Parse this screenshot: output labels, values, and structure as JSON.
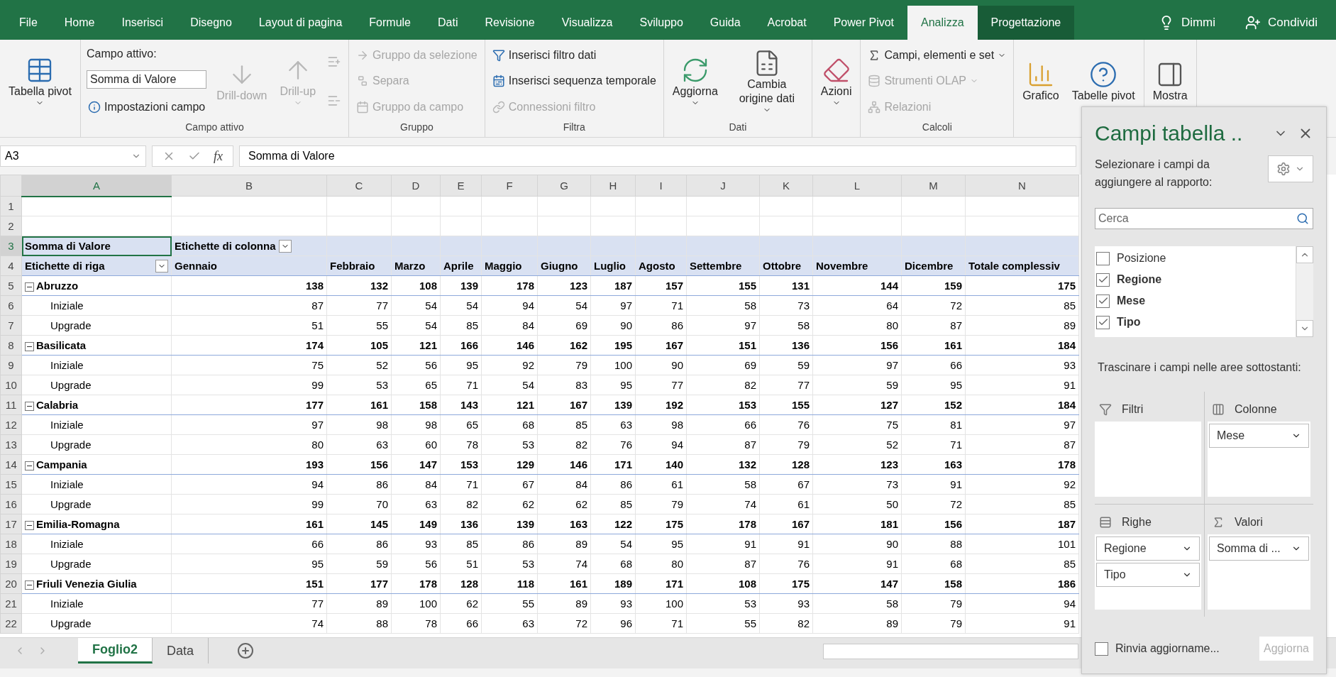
{
  "tabs": [
    {
      "label": "File",
      "selected": false,
      "contextual": false
    },
    {
      "label": "Home",
      "selected": false,
      "contextual": false
    },
    {
      "label": "Inserisci",
      "selected": false,
      "contextual": false
    },
    {
      "label": "Disegno",
      "selected": false,
      "contextual": false
    },
    {
      "label": "Layout di pagina",
      "selected": false,
      "contextual": false
    },
    {
      "label": "Formule",
      "selected": false,
      "contextual": false
    },
    {
      "label": "Dati",
      "selected": false,
      "contextual": false
    },
    {
      "label": "Revisione",
      "selected": false,
      "contextual": false
    },
    {
      "label": "Visualizza",
      "selected": false,
      "contextual": false
    },
    {
      "label": "Sviluppo",
      "selected": false,
      "contextual": false
    },
    {
      "label": "Guida",
      "selected": false,
      "contextual": false
    },
    {
      "label": "Acrobat",
      "selected": false,
      "contextual": false
    },
    {
      "label": "Power Pivot",
      "selected": false,
      "contextual": false
    },
    {
      "label": "Analizza",
      "selected": true,
      "contextual": true
    },
    {
      "label": "Progettazione",
      "selected": false,
      "contextual": true
    }
  ],
  "tell_me": "Dimmi",
  "share": "Condividi",
  "ribbon": [
    {
      "stacks": [
        [
          {
            "kind": "large",
            "label": "Tabella pivot",
            "caret": true,
            "disabled": false
          }
        ]
      ]
    },
    {
      "name": "Campo attivo",
      "stacks": [
        [
          {
            "kind": "label",
            "label": "Campo attivo:"
          },
          {
            "kind": "field",
            "value": "Somma di Valore"
          },
          {
            "kind": "small",
            "label": "Impostazioni campo",
            "caret": false,
            "disabled": false
          }
        ],
        [
          {
            "kind": "large",
            "label": "Drill-down",
            "caret": false,
            "disabled": true
          }
        ],
        [
          {
            "kind": "large",
            "label": "Drill-up",
            "caret": true,
            "disabled": true
          }
        ],
        [
          {
            "kind": "icon",
            "disabled": true
          },
          {
            "kind": "icon",
            "disabled": true
          }
        ]
      ]
    },
    {
      "name": "Gruppo",
      "stacks": [
        [
          {
            "kind": "small",
            "label": "Gruppo da selezione",
            "caret": false,
            "disabled": true
          },
          {
            "kind": "small",
            "label": "Separa",
            "caret": false,
            "disabled": true
          },
          {
            "kind": "small",
            "label": "Gruppo da campo",
            "caret": false,
            "disabled": true
          }
        ]
      ]
    },
    {
      "name": "Filtra",
      "stacks": [
        [
          {
            "kind": "small",
            "label": "Inserisci filtro dati",
            "caret": false,
            "disabled": false
          },
          {
            "kind": "small",
            "label": "Inserisci sequenza temporale",
            "caret": false,
            "disabled": false
          },
          {
            "kind": "small",
            "label": "Connessioni filtro",
            "caret": false,
            "disabled": true
          }
        ]
      ]
    },
    {
      "name": "Dati",
      "stacks": [
        [
          {
            "kind": "large",
            "label": "Aggiorna",
            "caret": true,
            "disabled": false
          }
        ],
        [
          {
            "kind": "large",
            "label": "Cambia origine dati",
            "caret": true,
            "disabled": false
          }
        ]
      ]
    },
    {
      "stacks": [
        [
          {
            "kind": "large",
            "label": "Azioni",
            "caret": true,
            "disabled": false
          }
        ]
      ]
    },
    {
      "name": "Calcoli",
      "stacks": [
        [
          {
            "kind": "small",
            "label": "Campi, elementi e set",
            "caret": true,
            "disabled": false
          },
          {
            "kind": "small",
            "label": "Strumenti OLAP",
            "caret": true,
            "disabled": true
          },
          {
            "kind": "small",
            "label": "Relazioni",
            "caret": false,
            "disabled": true
          }
        ]
      ]
    },
    {
      "stacks": [
        [
          {
            "kind": "large",
            "label": "Grafico",
            "caret": false,
            "disabled": false
          }
        ],
        [
          {
            "kind": "large",
            "label": "Tabelle pivot",
            "caret": false,
            "disabled": false
          }
        ]
      ]
    },
    {
      "stacks": [
        [
          {
            "kind": "large",
            "label": "Mostra",
            "caret": false,
            "disabled": false
          }
        ]
      ]
    }
  ],
  "formula_bar": {
    "name_box": "A3",
    "function_label": "fx",
    "formula": "Somma di Valore"
  },
  "column_letters": [
    "A",
    "B",
    "C",
    "D",
    "E",
    "F",
    "G",
    "H",
    "I",
    "J",
    "K",
    "L",
    "M",
    "N"
  ],
  "row_numbers": [
    "1",
    "2",
    "3",
    "4",
    "5",
    "6",
    "7",
    "8",
    "9",
    "10",
    "11",
    "12",
    "13",
    "14",
    "15",
    "16",
    "17",
    "18",
    "19",
    "20",
    "21",
    "22"
  ],
  "pivot": {
    "corner": {
      "label": "Somma di Valore",
      "selected": true
    },
    "column_field": "Etichette di colonna",
    "row_field": "Etichette di riga",
    "columns": [
      "Gennaio",
      "Febbraio",
      "Marzo",
      "Aprile",
      "Maggio",
      "Giugno",
      "Luglio",
      "Agosto",
      "Settembre",
      "Ottobre",
      "Novembre",
      "Dicembre",
      "Totale complessiv"
    ],
    "rows": [
      {
        "label": "Abruzzo",
        "expanded": true,
        "values": [
          "138",
          "132",
          "108",
          "139",
          "178",
          "123",
          "187",
          "157",
          "155",
          "131",
          "144",
          "159",
          "175"
        ],
        "children": [
          {
            "label": "Iniziale",
            "values": [
              "87",
              "77",
              "54",
              "54",
              "94",
              "54",
              "97",
              "71",
              "58",
              "73",
              "64",
              "72",
              "85"
            ]
          },
          {
            "label": "Upgrade",
            "values": [
              "51",
              "55",
              "54",
              "85",
              "84",
              "69",
              "90",
              "86",
              "97",
              "58",
              "80",
              "87",
              "89"
            ]
          }
        ]
      },
      {
        "label": "Basilicata",
        "expanded": true,
        "values": [
          "174",
          "105",
          "121",
          "166",
          "146",
          "162",
          "195",
          "167",
          "151",
          "136",
          "156",
          "161",
          "184"
        ],
        "children": [
          {
            "label": "Iniziale",
            "values": [
              "75",
              "52",
              "56",
              "95",
              "92",
              "79",
              "100",
              "90",
              "69",
              "59",
              "97",
              "66",
              "93"
            ]
          },
          {
            "label": "Upgrade",
            "values": [
              "99",
              "53",
              "65",
              "71",
              "54",
              "83",
              "95",
              "77",
              "82",
              "77",
              "59",
              "95",
              "91"
            ]
          }
        ]
      },
      {
        "label": "Calabria",
        "expanded": true,
        "values": [
          "177",
          "161",
          "158",
          "143",
          "121",
          "167",
          "139",
          "192",
          "153",
          "155",
          "127",
          "152",
          "184"
        ],
        "children": [
          {
            "label": "Iniziale",
            "values": [
              "97",
              "98",
              "98",
              "65",
              "68",
              "85",
              "63",
              "98",
              "66",
              "76",
              "75",
              "81",
              "97"
            ]
          },
          {
            "label": "Upgrade",
            "values": [
              "80",
              "63",
              "60",
              "78",
              "53",
              "82",
              "76",
              "94",
              "87",
              "79",
              "52",
              "71",
              "87"
            ]
          }
        ]
      },
      {
        "label": "Campania",
        "expanded": true,
        "values": [
          "193",
          "156",
          "147",
          "153",
          "129",
          "146",
          "171",
          "140",
          "132",
          "128",
          "123",
          "163",
          "178"
        ],
        "children": [
          {
            "label": "Iniziale",
            "values": [
              "94",
              "86",
              "84",
              "71",
              "67",
              "84",
              "86",
              "61",
              "58",
              "67",
              "73",
              "91",
              "92"
            ]
          },
          {
            "label": "Upgrade",
            "values": [
              "99",
              "70",
              "63",
              "82",
              "62",
              "62",
              "85",
              "79",
              "74",
              "61",
              "50",
              "72",
              "85"
            ]
          }
        ]
      },
      {
        "label": "Emilia-Romagna",
        "expanded": true,
        "values": [
          "161",
          "145",
          "149",
          "136",
          "139",
          "163",
          "122",
          "175",
          "178",
          "167",
          "181",
          "156",
          "187"
        ],
        "children": [
          {
            "label": "Iniziale",
            "values": [
              "66",
              "86",
              "93",
              "85",
              "86",
              "89",
              "54",
              "95",
              "91",
              "91",
              "90",
              "88",
              "101"
            ]
          },
          {
            "label": "Upgrade",
            "values": [
              "95",
              "59",
              "56",
              "51",
              "53",
              "74",
              "68",
              "80",
              "87",
              "76",
              "91",
              "68",
              "85"
            ]
          }
        ]
      },
      {
        "label": "Friuli Venezia Giulia",
        "expanded": true,
        "values": [
          "151",
          "177",
          "178",
          "128",
          "118",
          "161",
          "189",
          "171",
          "108",
          "175",
          "147",
          "158",
          "186"
        ],
        "children": [
          {
            "label": "Iniziale",
            "values": [
              "77",
              "89",
              "100",
              "62",
              "55",
              "89",
              "93",
              "100",
              "53",
              "93",
              "58",
              "79",
              "94"
            ]
          },
          {
            "label": "Upgrade",
            "values": [
              "74",
              "88",
              "78",
              "66",
              "63",
              "72",
              "96",
              "71",
              "55",
              "82",
              "89",
              "79",
              "91"
            ]
          }
        ]
      }
    ]
  },
  "sheet_tabs": [
    {
      "label": "Foglio2",
      "selected": true
    },
    {
      "label": "Data",
      "selected": false
    }
  ],
  "field_pane": {
    "title": "Campi tabella ..",
    "instructions": "Selezionare i campi da aggiungere al rapporto:",
    "search": {
      "placeholder": "Cerca"
    },
    "fields": [
      {
        "label": "Posizione",
        "checked": false
      },
      {
        "label": "Regione",
        "checked": true
      },
      {
        "label": "Mese",
        "checked": true
      },
      {
        "label": "Tipo",
        "checked": true
      }
    ],
    "drag_hint": "Trascinare i campi nelle aree sottostanti:",
    "areas": [
      {
        "kind": "filters",
        "title": "Filtri"
      },
      {
        "kind": "columns",
        "title": "Colonne",
        "items": [
          "Mese"
        ]
      },
      {
        "kind": "rows",
        "title": "Righe",
        "items": [
          "Regione",
          "Tipo"
        ]
      },
      {
        "kind": "values",
        "title": "Valori",
        "items": [
          "Somma di ..."
        ]
      }
    ],
    "defer": {
      "label": "Rinvia aggiorname...",
      "checked": false
    },
    "update_button": {
      "label": "Aggiorna",
      "disabled": true
    }
  }
}
